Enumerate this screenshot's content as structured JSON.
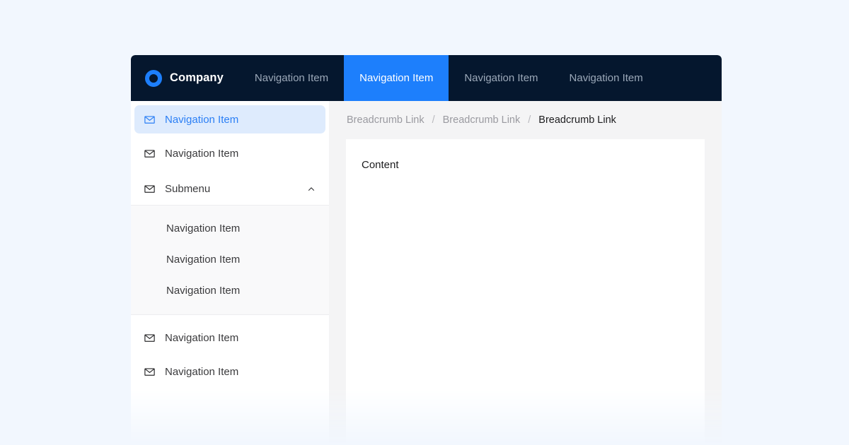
{
  "colors": {
    "page_background": "#F2F7FE",
    "navbar_background": "#05172E",
    "accent_blue": "#1D7FFC",
    "active_item_background": "#DEEBFD",
    "active_item_text": "#2B7FF5",
    "content_background": "#F4F4F5",
    "card_background": "#FFFFFF",
    "submenu_background": "#F9F9FA",
    "muted_text": "#9BA8B8"
  },
  "topnav": {
    "brand": {
      "logo_icon": "ring-logo-icon",
      "name": "Company"
    },
    "items": [
      {
        "label": "Navigation Item",
        "active": false
      },
      {
        "label": "Navigation Item",
        "active": true
      },
      {
        "label": "Navigation Item",
        "active": false
      },
      {
        "label": "Navigation Item",
        "active": false
      }
    ]
  },
  "sidebar": {
    "top_items": [
      {
        "label": "Navigation Item",
        "icon": "mail-icon",
        "active": true
      },
      {
        "label": "Navigation Item",
        "icon": "mail-icon",
        "active": false
      }
    ],
    "submenu": {
      "label": "Submenu",
      "icon": "mail-icon",
      "expanded": true,
      "chevron_icon": "chevron-up-icon",
      "items": [
        {
          "label": "Navigation Item"
        },
        {
          "label": "Navigation Item"
        },
        {
          "label": "Navigation Item"
        }
      ]
    },
    "bottom_items": [
      {
        "label": "Navigation Item",
        "icon": "mail-icon"
      },
      {
        "label": "Navigation Item",
        "icon": "mail-icon"
      }
    ]
  },
  "content": {
    "breadcrumb": {
      "separator": "/",
      "items": [
        {
          "label": "Breadcrumb Link",
          "current": false
        },
        {
          "label": "Breadcrumb Link",
          "current": false
        },
        {
          "label": "Breadcrumb Link",
          "current": true
        }
      ]
    },
    "body_text": "Content"
  }
}
